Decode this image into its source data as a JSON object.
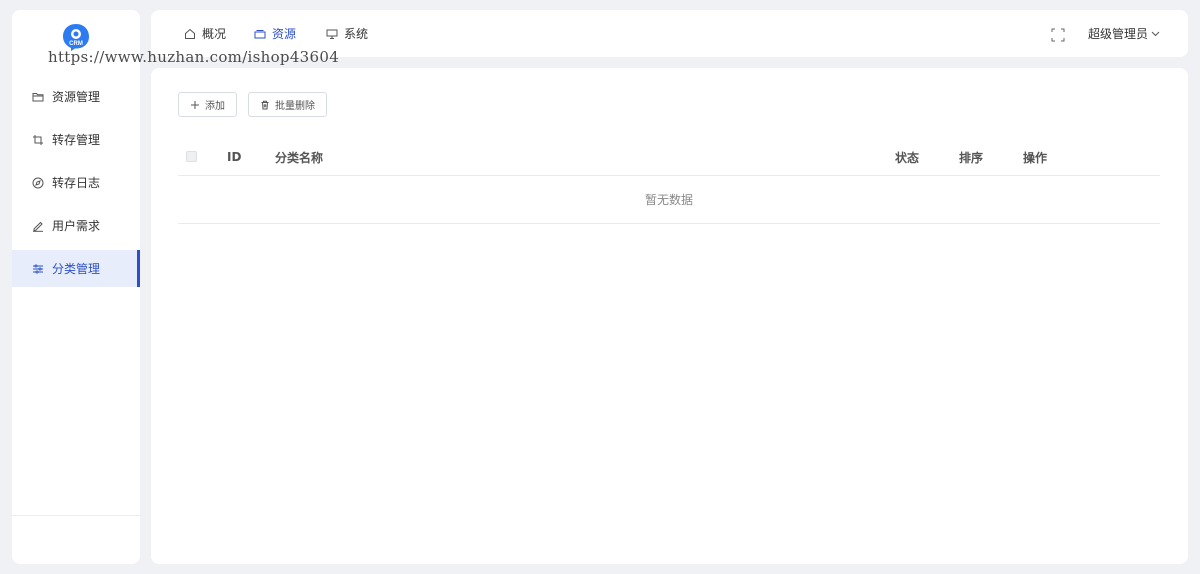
{
  "logo": {
    "text": "CRM",
    "color": "#2d7bf0"
  },
  "watermark": "https://www.huzhan.com/ishop43604",
  "sidebar": {
    "items": [
      {
        "label": "资源管理",
        "icon": "folder-icon",
        "active": false
      },
      {
        "label": "转存管理",
        "icon": "crop-icon",
        "active": false
      },
      {
        "label": "转存日志",
        "icon": "compass-icon",
        "active": false
      },
      {
        "label": "用户需求",
        "icon": "pen-icon",
        "active": false
      },
      {
        "label": "分类管理",
        "icon": "sliders-icon",
        "active": true
      }
    ]
  },
  "topbar": {
    "tabs": [
      {
        "label": "概况",
        "icon": "home-icon",
        "active": false
      },
      {
        "label": "资源",
        "icon": "layers-icon",
        "active": true
      },
      {
        "label": "系统",
        "icon": "monitor-icon",
        "active": false
      }
    ],
    "fullscreen_icon": "fullscreen-icon",
    "user": "超级管理员"
  },
  "toolbar": {
    "add_label": "添加",
    "batch_delete_label": "批量删除"
  },
  "table": {
    "columns": [
      "ID",
      "分类名称",
      "状态",
      "排序",
      "操作"
    ],
    "rows": [],
    "empty_text": "暂无数据"
  },
  "colors": {
    "accent": "#2d4fc8",
    "active_bg": "#e8edfb",
    "page_bg": "#eff1f5"
  }
}
